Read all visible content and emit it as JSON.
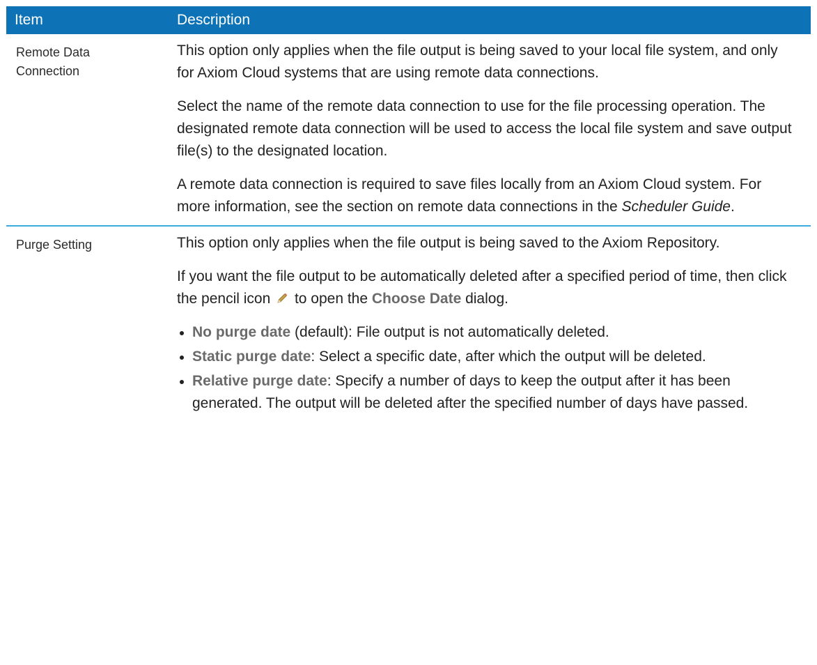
{
  "header": {
    "item": "Item",
    "description": "Description"
  },
  "rows": [
    {
      "item": "Remote Data Connection",
      "p1": "This option only applies when the file output is being saved to your local file system, and only for Axiom Cloud systems that are using remote data connections.",
      "p2": "Select the name of the remote data connection to use for the file processing operation. The designated remote data connection will be used to access the local file system and save output file(s) to the designated location.",
      "p3_before": "A remote data connection is required to save files locally from an Axiom Cloud system. For more information, see the section on remote data connections in the ",
      "p3_italic": "Scheduler Guide",
      "p3_after": "."
    },
    {
      "item": "Purge Setting",
      "p1": "This option only applies when the file output is being saved to the Axiom Repository.",
      "p2_before": "If you want the file output to be automatically deleted after a specified period of time, then click the pencil icon",
      "p2_middle": "to open the ",
      "p2_bold": "Choose Date",
      "p2_after": " dialog.",
      "pencil_icon": "pencil-icon",
      "bullets": [
        {
          "term": "No purge date",
          "text": " (default): File output is not automatically deleted."
        },
        {
          "term": "Static purge date",
          "text": ": Select a specific date, after which the output will be deleted."
        },
        {
          "term": "Relative purge date",
          "text": ": Specify a number of days to keep the output after it has been generated. The output will be deleted after the specified number of days have passed."
        }
      ]
    }
  ],
  "colors": {
    "header_bg": "#0d73b6",
    "row_divider": "#3aace0",
    "term_color": "#6a6a6a"
  }
}
